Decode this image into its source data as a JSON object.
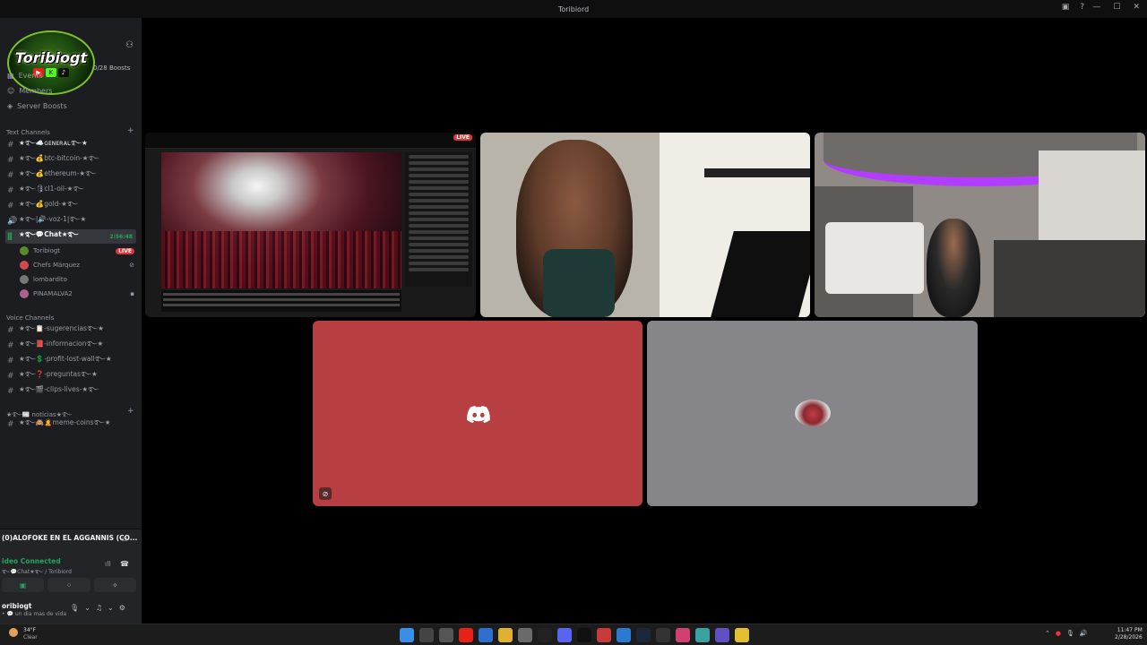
{
  "window": {
    "title": "Toribiord",
    "controls": [
      "—",
      "☐",
      "✕"
    ]
  },
  "server": {
    "logo_text": "Toribiogt",
    "boosts": "0/28 Boosts",
    "menu": [
      {
        "icon": "calendar-icon",
        "label": "Events"
      },
      {
        "icon": "members-icon",
        "label": "Members"
      },
      {
        "icon": "boost-icon",
        "label": "Server Boosts"
      }
    ]
  },
  "sections": {
    "text": "Text Channels",
    "voice": "Voice Channels"
  },
  "text_channels": [
    "★࿐☁️ɢᴇɴᴇʀᴀʟ࿐★",
    "★࿐💰btc-bitcoin-★࿐",
    "★࿐💰ethereum-★࿐",
    "★࿐🛢cl1-oil-★࿐",
    "★࿐💰gold-★࿐",
    "★࿐|🔊-voz-1|࿐★",
    "★࿐💬Chat★࿐"
  ],
  "active_channel_timer": "2:56:48",
  "voice_members": [
    {
      "name": "Toribiogt",
      "badge": "LIVE",
      "color": "#5a8a2a"
    },
    {
      "name": "Chefs Márquez",
      "badge": "",
      "color": "#d04a4a"
    },
    {
      "name": "lombardito",
      "badge": "",
      "color": "#777777"
    },
    {
      "name": "PINAMALVA2",
      "badge": "",
      "color": "#b06090"
    }
  ],
  "voice_channels": [
    "★࿐📋-sugerencias࿐★",
    "★࿐📕-informacion࿐★",
    "★࿐💲-profit-lost-wall࿐★",
    "★࿐❓-preguntas࿐★",
    "★࿐🎬-clips-lives-★࿐"
  ],
  "extra_category": "★࿐📰 noticias★࿐",
  "extra_channel": "★࿐🙈🙎meme-coins࿐★",
  "voice_panel": {
    "stream": "(0)ALOFOKE EN EL AGGANNIS (CO...",
    "status": "ideo Connected",
    "channel": "࿐💬Chat★࿐ / Toribiord"
  },
  "user": {
    "name": "oribiogt",
    "status": "• 💬 un dia mas de vida"
  },
  "stream_badge": "LIVE",
  "taskbar": {
    "temp": "34°F",
    "condition": "Clear",
    "time": "11:47 PM",
    "date": "2/28/2026"
  },
  "colors": {
    "discord_red_tile": "#b83f41",
    "grey_tile": "#85858a",
    "live_red": "#da373c",
    "connected_green": "#23a559"
  }
}
